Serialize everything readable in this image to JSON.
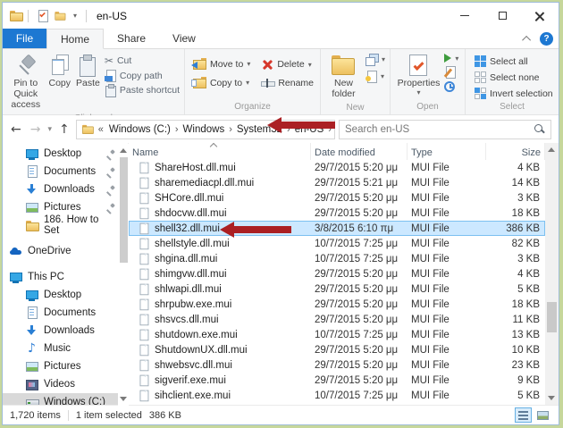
{
  "window": {
    "title": "en-US"
  },
  "tabs": {
    "file": "File",
    "home": "Home",
    "share": "Share",
    "view": "View"
  },
  "ribbon": {
    "clipboard": {
      "pin": "Pin to Quick access",
      "copy": "Copy",
      "paste": "Paste",
      "cut": "Cut",
      "copy_path": "Copy path",
      "paste_shortcut": "Paste shortcut",
      "label": "Clipboard"
    },
    "organize": {
      "move_to": "Move to",
      "copy_to": "Copy to",
      "delete": "Delete",
      "rename": "Rename",
      "label": "Organize"
    },
    "new_group": {
      "new_folder": "New folder",
      "label": "New"
    },
    "open_group": {
      "properties": "Properties",
      "label": "Open"
    },
    "select_group": {
      "select_all": "Select all",
      "select_none": "Select none",
      "invert": "Invert selection",
      "label": "Select"
    }
  },
  "addressbar": {
    "overflow": "«",
    "crumbs": [
      {
        "label": "Windows (C:)"
      },
      {
        "label": "Windows"
      },
      {
        "label": "System32"
      },
      {
        "label": "en-US"
      }
    ],
    "search_placeholder": "Search en-US"
  },
  "sidebar": {
    "items": [
      {
        "label": "Desktop",
        "icon": "desktop",
        "pin": true,
        "indent": 1
      },
      {
        "label": "Documents",
        "icon": "docs",
        "pin": true,
        "indent": 1
      },
      {
        "label": "Downloads",
        "icon": "dl",
        "pin": true,
        "indent": 1
      },
      {
        "label": "Pictures",
        "icon": "pics",
        "pin": true,
        "indent": 1
      },
      {
        "label": "186. How to Set",
        "icon": "folder",
        "pin": false,
        "indent": 1
      },
      {
        "label": "OneDrive",
        "icon": "cloud",
        "pin": false,
        "indent": 0,
        "gap": true
      },
      {
        "label": "This PC",
        "icon": "pc",
        "pin": false,
        "indent": 0,
        "gap": true
      },
      {
        "label": "Desktop",
        "icon": "desktop",
        "pin": false,
        "indent": 1
      },
      {
        "label": "Documents",
        "icon": "docs",
        "pin": false,
        "indent": 1
      },
      {
        "label": "Downloads",
        "icon": "dl",
        "pin": false,
        "indent": 1
      },
      {
        "label": "Music",
        "icon": "music",
        "pin": false,
        "indent": 1
      },
      {
        "label": "Pictures",
        "icon": "pics",
        "pin": false,
        "indent": 1
      },
      {
        "label": "Videos",
        "icon": "video",
        "pin": false,
        "indent": 1
      },
      {
        "label": "Windows (C:)",
        "icon": "drive",
        "pin": false,
        "indent": 1,
        "selected": true
      }
    ]
  },
  "files": {
    "columns": {
      "name": "Name",
      "date": "Date modified",
      "type": "Type",
      "size": "Size"
    },
    "rows": [
      {
        "name": "ShareHost.dll.mui",
        "date": "29/7/2015 5:20 μμ",
        "type": "MUI File",
        "size": "4 KB"
      },
      {
        "name": "sharemediacpl.dll.mui",
        "date": "29/7/2015 5:21 μμ",
        "type": "MUI File",
        "size": "14 KB"
      },
      {
        "name": "SHCore.dll.mui",
        "date": "29/7/2015 5:20 μμ",
        "type": "MUI File",
        "size": "3 KB"
      },
      {
        "name": "shdocvw.dll.mui",
        "date": "29/7/2015 5:20 μμ",
        "type": "MUI File",
        "size": "18 KB"
      },
      {
        "name": "shell32.dll.mui",
        "date": "3/8/2015 6:10 πμ",
        "type": "MUI File",
        "size": "386 KB",
        "selected": true
      },
      {
        "name": "shellstyle.dll.mui",
        "date": "10/7/2015 7:25 μμ",
        "type": "MUI File",
        "size": "82 KB"
      },
      {
        "name": "shgina.dll.mui",
        "date": "10/7/2015 7:25 μμ",
        "type": "MUI File",
        "size": "3 KB"
      },
      {
        "name": "shimgvw.dll.mui",
        "date": "29/7/2015 5:20 μμ",
        "type": "MUI File",
        "size": "4 KB"
      },
      {
        "name": "shlwapi.dll.mui",
        "date": "29/7/2015 5:20 μμ",
        "type": "MUI File",
        "size": "5 KB"
      },
      {
        "name": "shrpubw.exe.mui",
        "date": "29/7/2015 5:20 μμ",
        "type": "MUI File",
        "size": "18 KB"
      },
      {
        "name": "shsvcs.dll.mui",
        "date": "29/7/2015 5:20 μμ",
        "type": "MUI File",
        "size": "11 KB"
      },
      {
        "name": "shutdown.exe.mui",
        "date": "10/7/2015 7:25 μμ",
        "type": "MUI File",
        "size": "13 KB"
      },
      {
        "name": "ShutdownUX.dll.mui",
        "date": "29/7/2015 5:20 μμ",
        "type": "MUI File",
        "size": "10 KB"
      },
      {
        "name": "shwebsvc.dll.mui",
        "date": "29/7/2015 5:20 μμ",
        "type": "MUI File",
        "size": "23 KB"
      },
      {
        "name": "sigverif.exe.mui",
        "date": "29/7/2015 5:20 μμ",
        "type": "MUI File",
        "size": "9 KB"
      },
      {
        "name": "sihclient.exe.mui",
        "date": "10/7/2015 7:25 μμ",
        "type": "MUI File",
        "size": "5 KB"
      }
    ]
  },
  "statusbar": {
    "items_count": "1,720 items",
    "selection": "1 item selected",
    "selection_size": "386 KB"
  },
  "colors": {
    "accent_blue": "#1d78d2",
    "selection_blue": "#cce8ff",
    "annotation_red": "#ab2024",
    "frame_green": "#c6d79b"
  }
}
